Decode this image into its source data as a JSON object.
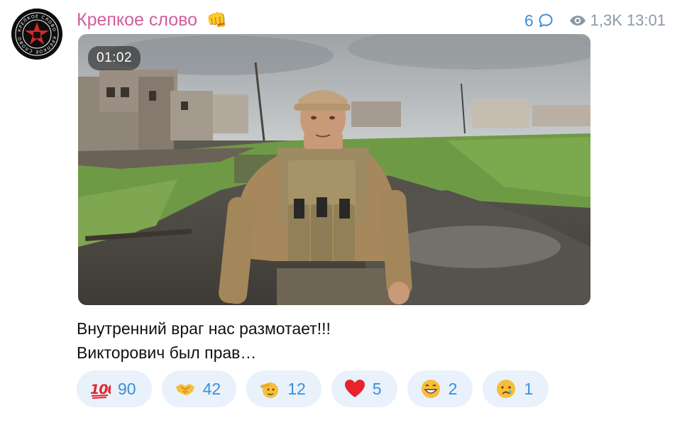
{
  "post": {
    "channel_name": "Крепкое слово",
    "channel_emoji": "👊",
    "avatar_text": "КРЕПКОЕ СЛОВО",
    "comments_count": "6",
    "views": "1,3K",
    "time": "13:01",
    "video": {
      "duration": "01:02"
    },
    "text_lines": [
      "Внутренний враг нас размотает!!!",
      "Викторович был прав…"
    ],
    "reactions": [
      {
        "icon": "hundred-points-icon",
        "count": "90"
      },
      {
        "icon": "handshake-icon",
        "count": "42"
      },
      {
        "icon": "saluting-face-icon",
        "count": "12"
      },
      {
        "icon": "red-heart-icon",
        "count": "5"
      },
      {
        "icon": "grinning-face-icon",
        "count": "2"
      },
      {
        "icon": "crying-face-icon",
        "count": "1"
      }
    ]
  },
  "colors": {
    "accent": "#3a8fd8",
    "channel": "#d35d9a",
    "meta": "#8d99a6",
    "reaction_bg": "#e9f1fb"
  }
}
